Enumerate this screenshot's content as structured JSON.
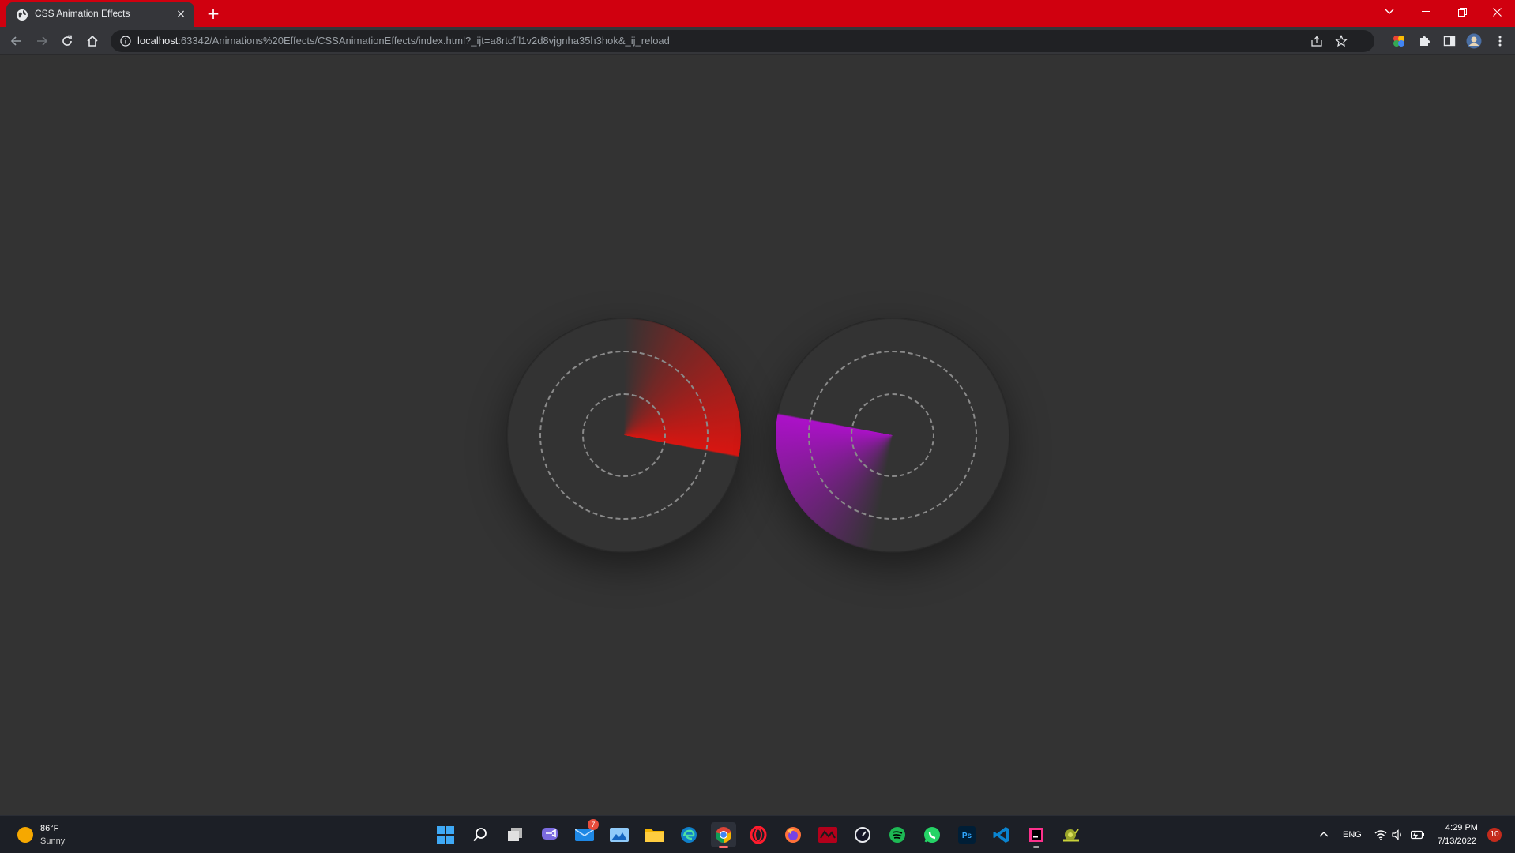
{
  "browser": {
    "tab_title": "CSS Animation Effects",
    "tab_close": "×",
    "new_tab": "+",
    "url_host": "localhost",
    "url_rest": ":63342/Animations%20Effects/CSSAnimationEffects/index.html?_ijt=a8rtcffl1v2d8vjgnha35h3hok&_ij_reload",
    "accent_color": "#d0000f"
  },
  "radars": [
    {
      "name": "red-radar",
      "color": "#e0140f"
    },
    {
      "name": "purple-radar",
      "color": "#b20fd0"
    }
  ],
  "taskbar": {
    "weather_temp": "86°F",
    "weather_condition": "Sunny",
    "mail_badge": "7",
    "language": "ENG",
    "time": "4:29 PM",
    "date": "7/13/2022",
    "notification_count": "10"
  }
}
